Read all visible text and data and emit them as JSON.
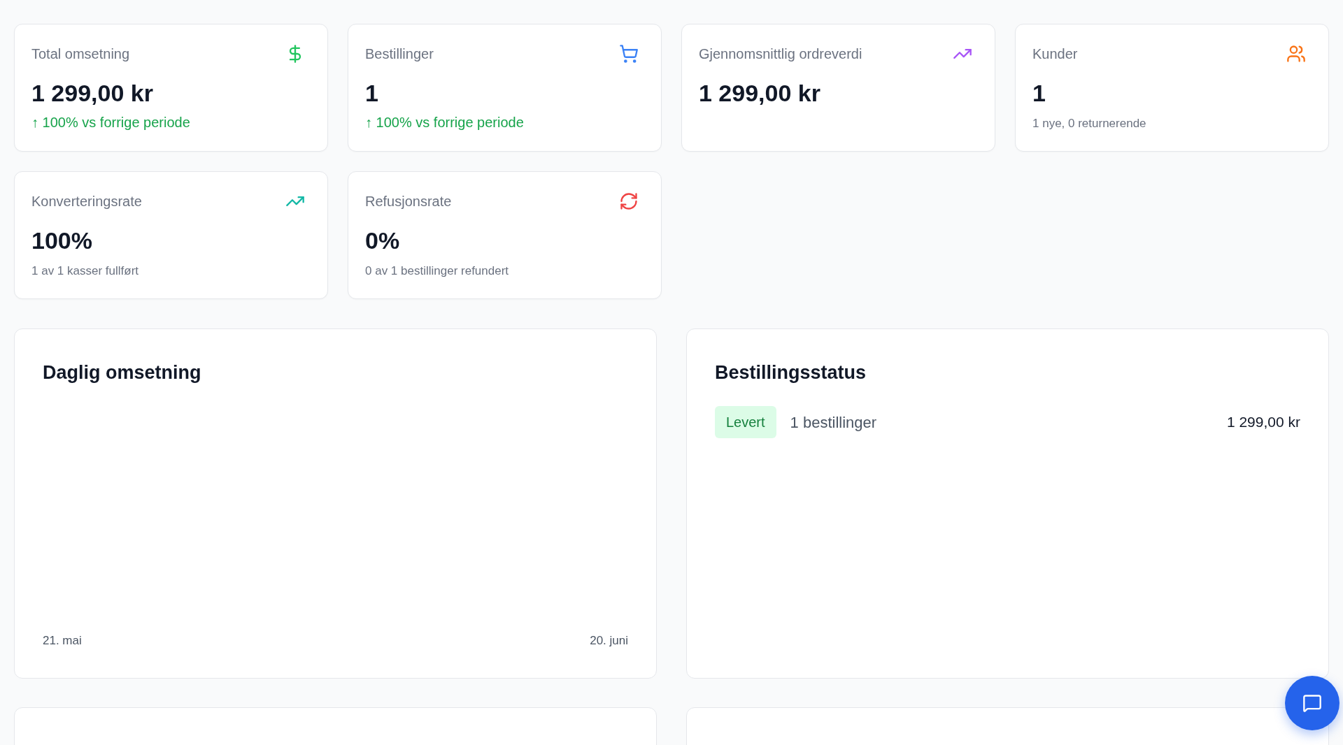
{
  "metric_cards": [
    {
      "label": "Total omsetning",
      "value": "1 299,00 kr",
      "change": {
        "positive": true,
        "text": "↑ 100% vs forrige periode"
      }
    },
    {
      "label": "Bestillinger",
      "value": "1",
      "change": {
        "positive": true,
        "text": "↑ 100% vs forrige periode"
      }
    },
    {
      "label": "Gjennomsnittlig ordreverdi",
      "value": "1 299,00 kr"
    },
    {
      "label": "Kunder",
      "value": "1",
      "note": "1 nye, 0 returnerende"
    },
    {
      "label": "Konverteringsrate",
      "value": "100%",
      "note": "1 av 1 kasser fullført"
    },
    {
      "label": "Refusjonsrate",
      "value": "0%",
      "note": "0 av 1 bestillinger refundert"
    }
  ],
  "daily_revenue": {
    "title": "Daglig omsetning",
    "x_labels": [
      "21. mai",
      "20. juni"
    ]
  },
  "order_status": {
    "title": "Bestillingsstatus",
    "rows": [
      {
        "kind": "delivered",
        "status": "Levert",
        "count": "1 bestillinger",
        "amount": "1 299,00 kr"
      }
    ]
  }
}
